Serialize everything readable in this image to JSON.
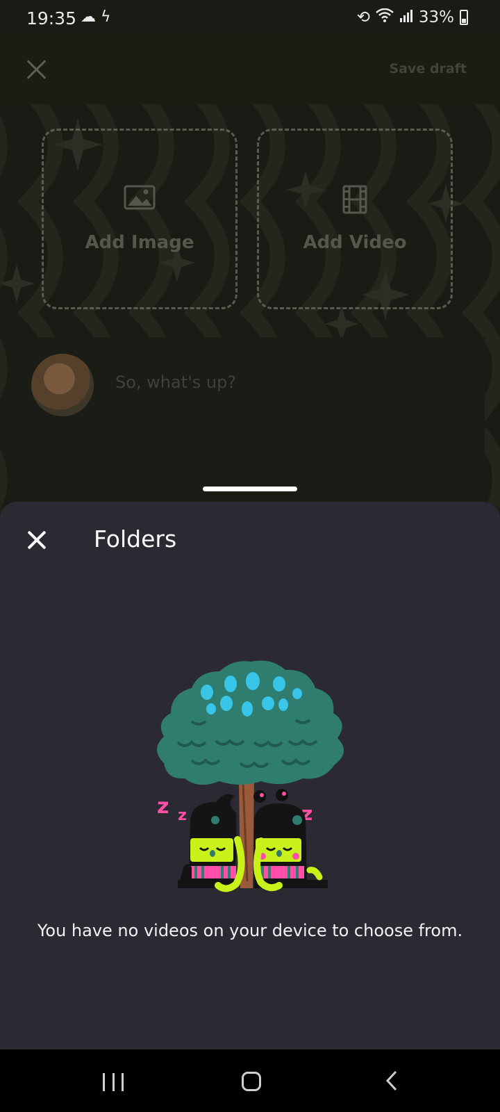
{
  "status_bar": {
    "time": "19:35",
    "left_icons": "☁ ϟ",
    "battery": "33%"
  },
  "composer": {
    "save_draft": "Save draft",
    "add_image": "Add Image",
    "add_video": "Add Video",
    "placeholder": "So, what's up?"
  },
  "sheet": {
    "title": "Folders",
    "empty_message": "You have no videos on your device to choose from."
  },
  "icons": {
    "close": "close-icon",
    "image": "image-icon",
    "video": "film-icon",
    "recents": "recents-icon",
    "home": "home-icon",
    "back": "back-icon"
  },
  "colors": {
    "sheet_bg": "#2b2a33",
    "background_dim": "#1a1b14",
    "accent_tree": "#2f7d6f",
    "accent_lime": "#c8f21a",
    "accent_pink": "#ff4fa7"
  }
}
